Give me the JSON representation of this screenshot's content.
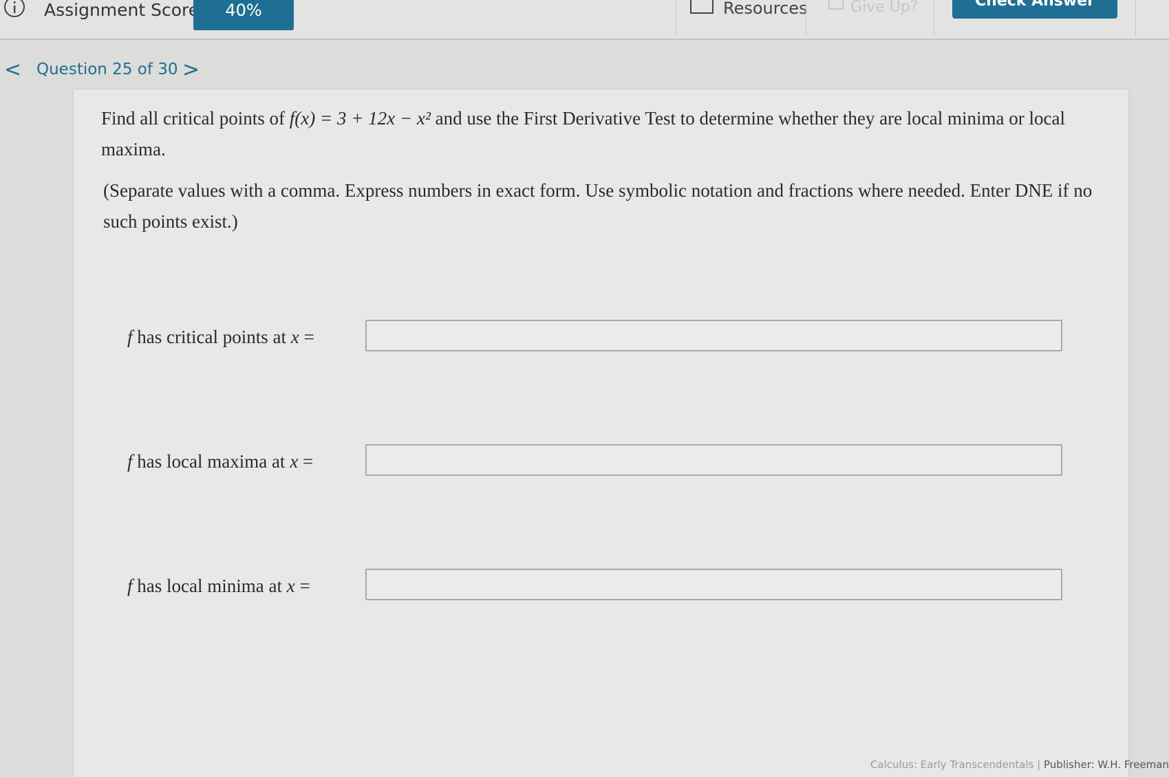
{
  "topbar": {
    "score_label": "Assignment Score:",
    "score_value": "40%",
    "resources_label": "Resources",
    "giveup_label": "Give Up?",
    "check_answer_label": "Check Answer"
  },
  "nav": {
    "prev_glyph": "<",
    "next_glyph": ">",
    "question_label": "Question 25 of 30"
  },
  "question": {
    "prompt_before": "Find all critical points of ",
    "function_text": "f(x) = 3 + 12x − x²",
    "prompt_after": " and use the First Derivative Test to determine whether they are local minima or local maxima.",
    "instructions": "(Separate values with a comma. Express numbers in exact form. Use symbolic notation and fractions where needed. Enter DNE if no such points exist.)",
    "answers": [
      {
        "label_prefix": "f",
        "label_text": " has critical points at ",
        "label_var": "x",
        "label_eq": " =",
        "value": ""
      },
      {
        "label_prefix": "f",
        "label_text": " has local maxima at ",
        "label_var": "x",
        "label_eq": " =",
        "value": ""
      },
      {
        "label_prefix": "f",
        "label_text": " has local minima at ",
        "label_var": "x",
        "label_eq": " =",
        "value": ""
      }
    ]
  },
  "footer": {
    "book": "Calculus: Early Transcendentals",
    "separator": "|",
    "publisher": "Publisher: W.H. Freeman"
  }
}
